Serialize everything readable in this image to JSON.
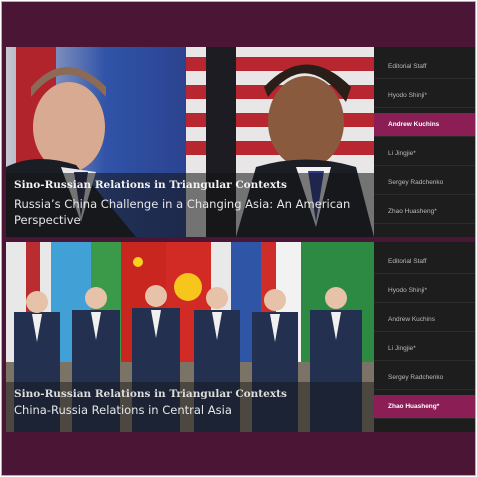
{
  "panels": [
    {
      "caption_kicker": "Sino-Russian Relations in Triangular Contexts",
      "caption_title": "Russia’s China Challenge in a Changing Asia: An American Perspective",
      "menu": [
        "Editorial Staff",
        "Hyodo Shinji*",
        "Andrew Kuchins",
        "Li Jingjie*",
        "Sergey Radchenko",
        "Zhao Huasheng*"
      ],
      "active_index": 2
    },
    {
      "caption_kicker": "Sino-Russian Relations in Triangular Contexts",
      "caption_title": "China-Russia Relations in Central Asia",
      "menu": [
        "Editorial Staff",
        "Hyodo Shinji*",
        "Andrew Kuchins",
        "Li Jingjie*",
        "Sergey Radchenko",
        "Zhao Huasheng*"
      ],
      "active_index": 5
    }
  ],
  "colors": {
    "frame": "#4b1535",
    "active_item": "#8a1e55",
    "sidebar": "#1d1d1d"
  }
}
